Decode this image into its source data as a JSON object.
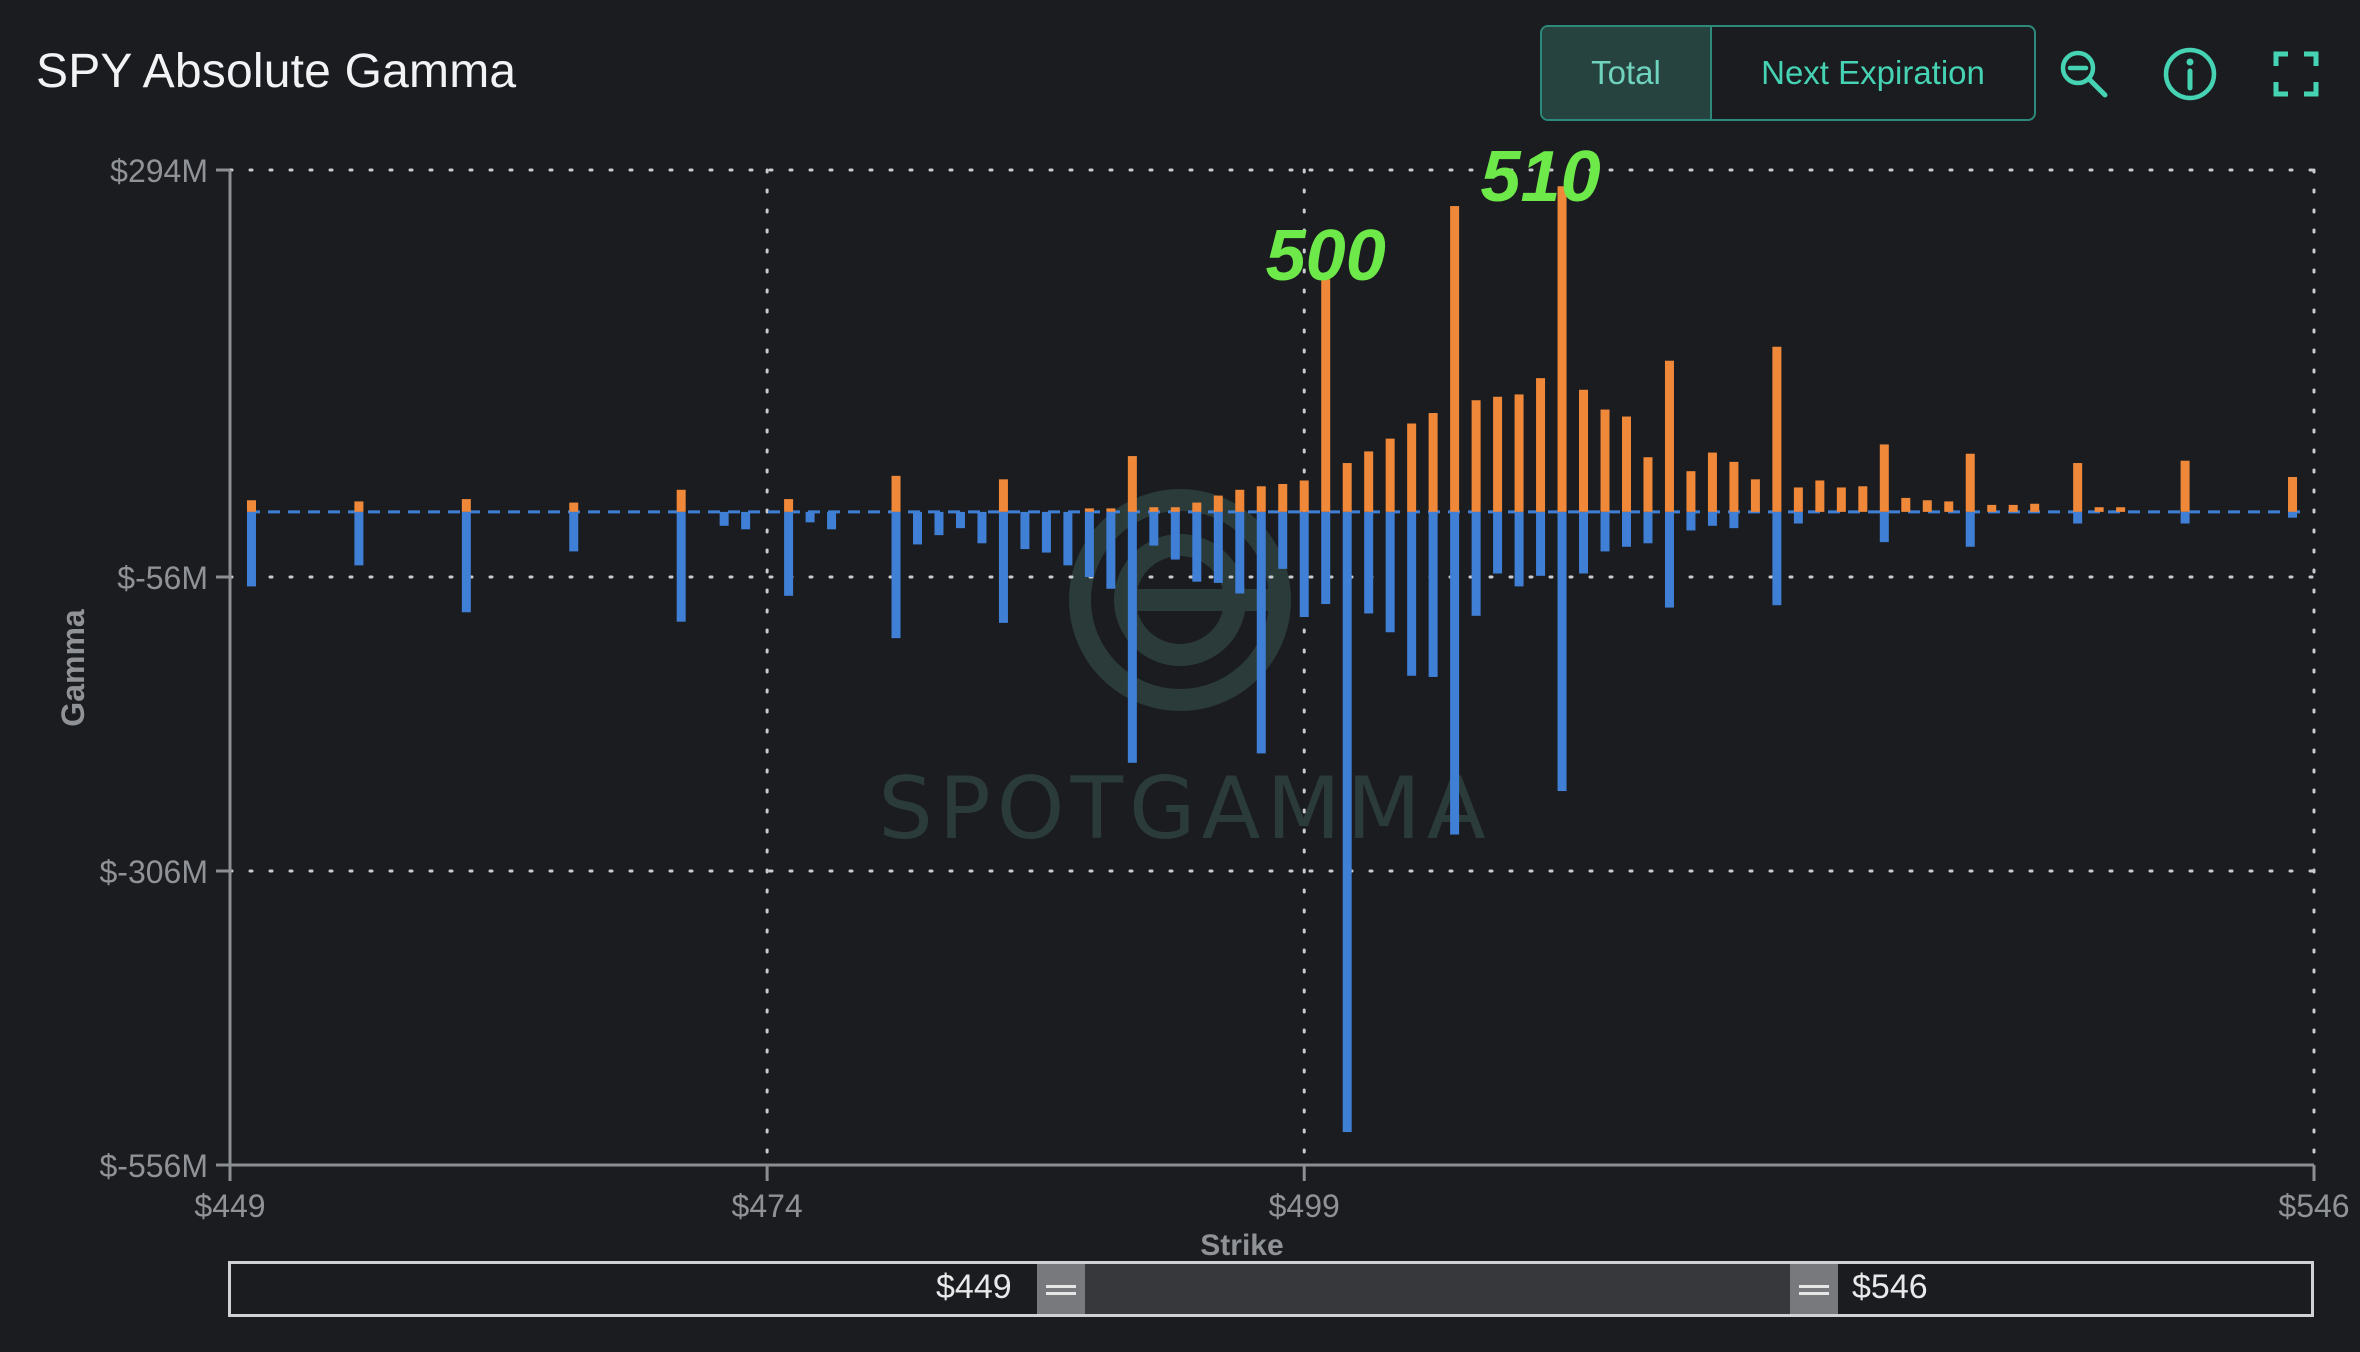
{
  "header": {
    "title": "SPY Absolute Gamma",
    "toggle_total": "Total",
    "toggle_next": "Next Expiration"
  },
  "icons": {
    "zoom": "zoom-out-icon",
    "info": "info-icon",
    "fullscreen": "fullscreen-icon"
  },
  "watermark": "SPOTGAMMA",
  "colors": {
    "call": "#f0883a",
    "put": "#3f7fd6",
    "accent": "#45d3b4",
    "annotation": "#6ee94a"
  },
  "range_slider": {
    "min_label": "$449",
    "max_label": "$546"
  },
  "chart_data": {
    "type": "bar",
    "xlabel": "Strike",
    "ylabel": "Gamma",
    "xlim": [
      449,
      546
    ],
    "ylim": [
      -556,
      294
    ],
    "x_ticks": [
      449,
      474,
      499,
      546
    ],
    "x_tick_labels": [
      "$449",
      "$474",
      "$499",
      "$546"
    ],
    "y_ticks": [
      294,
      -56,
      -306,
      -556
    ],
    "y_tick_labels": [
      "$294M",
      "$-56M",
      "$-306M",
      "$-556M"
    ],
    "grid": true,
    "annotations": [
      {
        "text": "500",
        "x": 500,
        "y": 220
      },
      {
        "text": "510",
        "x": 510,
        "y": 288
      }
    ],
    "series": [
      {
        "color": "#f0883a",
        "points": [
          [
            450,
            10
          ],
          [
            455,
            9
          ],
          [
            460,
            11
          ],
          [
            465,
            8
          ],
          [
            470,
            19
          ],
          [
            475,
            11
          ],
          [
            480,
            31
          ],
          [
            485,
            28
          ],
          [
            489,
            3
          ],
          [
            490,
            3
          ],
          [
            491,
            48
          ],
          [
            492,
            4
          ],
          [
            493,
            4
          ],
          [
            494,
            8
          ],
          [
            495,
            14
          ],
          [
            496,
            19
          ],
          [
            497,
            22
          ],
          [
            498,
            24
          ],
          [
            499,
            27
          ],
          [
            500,
            200
          ],
          [
            501,
            42
          ],
          [
            502,
            52
          ],
          [
            503,
            63
          ],
          [
            504,
            76
          ],
          [
            505,
            85
          ],
          [
            506,
            263
          ],
          [
            507,
            96
          ],
          [
            508,
            99
          ],
          [
            509,
            101
          ],
          [
            510,
            115
          ],
          [
            511,
            280
          ],
          [
            512,
            105
          ],
          [
            513,
            88
          ],
          [
            514,
            82
          ],
          [
            515,
            47
          ],
          [
            516,
            130
          ],
          [
            517,
            35
          ],
          [
            518,
            51
          ],
          [
            519,
            43
          ],
          [
            520,
            28
          ],
          [
            521,
            142
          ],
          [
            522,
            21
          ],
          [
            523,
            27
          ],
          [
            524,
            21
          ],
          [
            525,
            22
          ],
          [
            526,
            58
          ],
          [
            527,
            12
          ],
          [
            528,
            10
          ],
          [
            529,
            9
          ],
          [
            530,
            50
          ],
          [
            531,
            6
          ],
          [
            532,
            6
          ],
          [
            533,
            7
          ],
          [
            535,
            42
          ],
          [
            536,
            4
          ],
          [
            537,
            4
          ],
          [
            540,
            44
          ],
          [
            545,
            30
          ]
        ]
      },
      {
        "color": "#3f7fd6",
        "points": [
          [
            450,
            -64
          ],
          [
            455,
            -46
          ],
          [
            460,
            -86
          ],
          [
            465,
            -34
          ],
          [
            470,
            -94
          ],
          [
            472,
            -12
          ],
          [
            473,
            -15
          ],
          [
            475,
            -72
          ],
          [
            476,
            -9
          ],
          [
            477,
            -15
          ],
          [
            480,
            -108
          ],
          [
            481,
            -28
          ],
          [
            482,
            -20
          ],
          [
            483,
            -14
          ],
          [
            484,
            -27
          ],
          [
            485,
            -95
          ],
          [
            486,
            -32
          ],
          [
            487,
            -35
          ],
          [
            488,
            -46
          ],
          [
            489,
            -56
          ],
          [
            490,
            -66
          ],
          [
            491,
            -214
          ],
          [
            492,
            -29
          ],
          [
            493,
            -41
          ],
          [
            494,
            -60
          ],
          [
            495,
            -61
          ],
          [
            496,
            -70
          ],
          [
            497,
            -206
          ],
          [
            498,
            -49
          ],
          [
            499,
            -90
          ],
          [
            500,
            -79
          ],
          [
            501,
            -528
          ],
          [
            502,
            -87
          ],
          [
            503,
            -103
          ],
          [
            504,
            -140
          ],
          [
            505,
            -141
          ],
          [
            506,
            -275
          ],
          [
            507,
            -89
          ],
          [
            508,
            -53
          ],
          [
            509,
            -64
          ],
          [
            510,
            -55
          ],
          [
            511,
            -238
          ],
          [
            512,
            -53
          ],
          [
            513,
            -34
          ],
          [
            514,
            -30
          ],
          [
            515,
            -27
          ],
          [
            516,
            -82
          ],
          [
            517,
            -16
          ],
          [
            518,
            -12
          ],
          [
            519,
            -14
          ],
          [
            521,
            -80
          ],
          [
            522,
            -10
          ],
          [
            526,
            -26
          ],
          [
            530,
            -30
          ],
          [
            535,
            -10
          ],
          [
            540,
            -10
          ],
          [
            545,
            -5
          ]
        ]
      }
    ]
  }
}
